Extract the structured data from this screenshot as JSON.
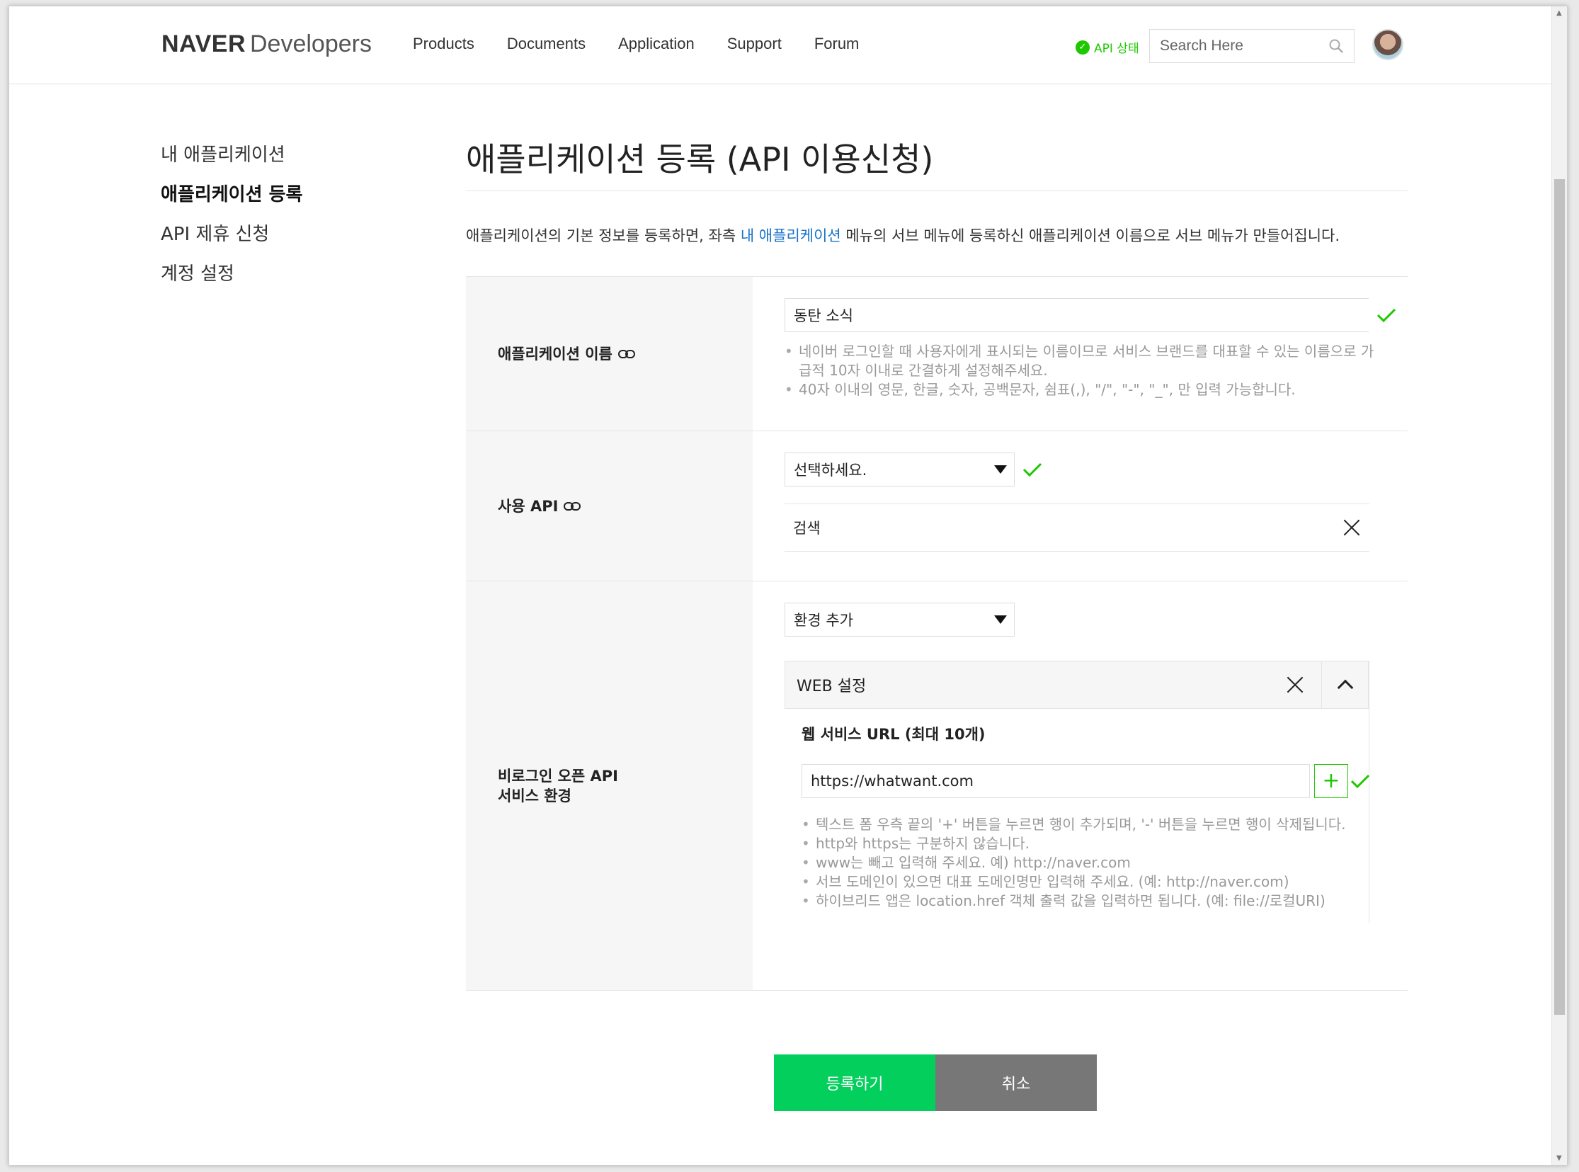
{
  "header": {
    "logo_bold": "NAVER",
    "logo_regular": "Developers",
    "nav": [
      "Products",
      "Documents",
      "Application",
      "Support",
      "Forum"
    ],
    "api_status": "API 상태",
    "search_placeholder": "Search Here"
  },
  "sidebar": {
    "items": [
      {
        "label": "내 애플리케이션",
        "active": false
      },
      {
        "label": "애플리케이션 등록",
        "active": true
      },
      {
        "label": "API 제휴 신청",
        "active": false
      },
      {
        "label": "계정 설정",
        "active": false
      }
    ]
  },
  "main": {
    "title": "애플리케이션 등록 (API 이용신청)",
    "desc_before": "애플리케이션의 기본 정보를 등록하면, 좌측 ",
    "desc_link": "내 애플리케이션",
    "desc_after": " 메뉴의 서브 메뉴에 등록하신 애플리케이션 이름으로 서브 메뉴가 만들어집니다."
  },
  "form": {
    "app_name": {
      "label": "애플리케이션 이름",
      "value": "동탄 소식",
      "hints": [
        "네이버 로그인할 때 사용자에게 표시되는 이름이므로 서비스 브랜드를 대표할 수 있는 이름으로 가급적 10자 이내로 간결하게 설정해주세요.",
        "40자 이내의 영문, 한글, 숫자, 공백문자, 쉼표(,), \"/\", \"-\", \"_\", 만 입력 가능합니다."
      ]
    },
    "use_api": {
      "label": "사용 API",
      "select_value": "선택하세요.",
      "selected_item": "검색"
    },
    "environment": {
      "label_line1": "비로그인 오픈 API",
      "label_line2": "서비스 환경",
      "select_value": "환경 추가",
      "section_title": "WEB 설정",
      "sub_title": "웹 서비스 URL (최대 10개)",
      "url_value": "https://whatwant.com",
      "hints": [
        "텍스트 폼 우측 끝의 '+' 버튼을 누르면 행이 추가되며, '-' 버튼을 누르면 행이 삭제됩니다.",
        "http와 https는 구분하지 않습니다.",
        "www는 빼고 입력해 주세요. 예) http://naver.com",
        "서브 도메인이 있으면 대표 도메인명만 입력해 주세요. (예: http://naver.com)",
        "하이브리드 앱은 location.href 객체 출력 값을 입력하면 됩니다. (예: file://로컬URI)"
      ]
    }
  },
  "buttons": {
    "submit": "등록하기",
    "cancel": "취소"
  },
  "colors": {
    "naver_green": "#03cf5d",
    "check_green": "#1ec800",
    "link_blue": "#1a73c8"
  }
}
